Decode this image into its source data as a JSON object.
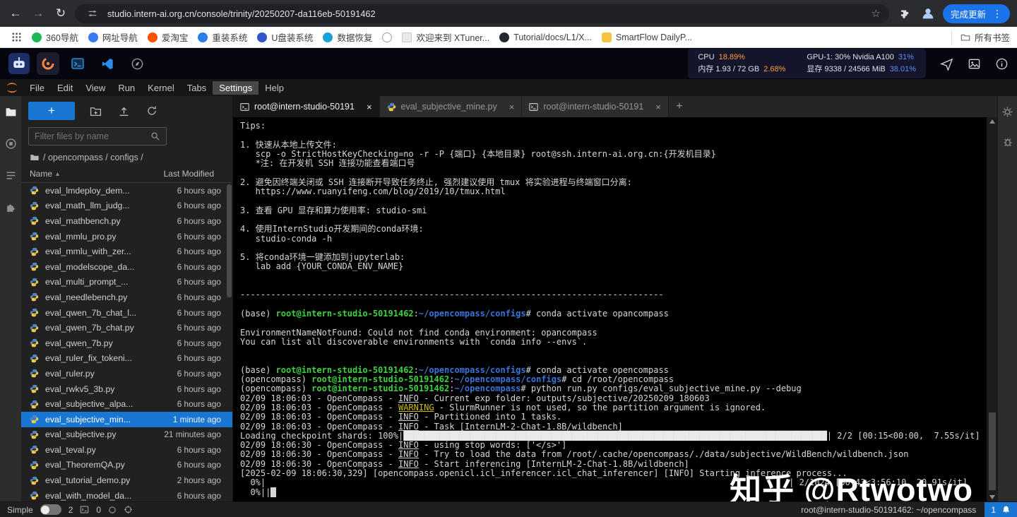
{
  "icons": {
    "back": "←",
    "forward": "→",
    "refresh": "↻",
    "star": "☆",
    "kebab": "⋮",
    "plus": "+",
    "caret": "▴",
    "close": "×"
  },
  "browser": {
    "url": "studio.intern-ai.org.cn/console/trinity/20250207-da116eb-50191462",
    "update_button": "完成更新",
    "all_bookmarks": "所有书签",
    "bookmarks": [
      {
        "label": "360导航",
        "color": "#1db954",
        "kind": "circle"
      },
      {
        "label": "网址导航",
        "color": "#3a7af0",
        "kind": "circle"
      },
      {
        "label": "爱淘宝",
        "color": "#ff5000",
        "kind": "circle"
      },
      {
        "label": "重装系统",
        "color": "#2b7de9",
        "kind": "circle"
      },
      {
        "label": "U盘装系统",
        "color": "#3355cc",
        "kind": "circle"
      },
      {
        "label": "数据恢复",
        "color": "#18a0d8",
        "kind": "circle"
      },
      {
        "label": "",
        "color": "#9aa0a6",
        "kind": "globe"
      },
      {
        "label": "欢迎来到 XTuner...",
        "color": "#e8eaed",
        "kind": "doc"
      },
      {
        "label": "Tutorial/docs/L1/X...",
        "color": "#24292f",
        "kind": "circle"
      },
      {
        "label": "SmartFlow DailyP...",
        "color": "#f6c443",
        "kind": "square"
      }
    ]
  },
  "studio": {
    "cpu_label": "CPU",
    "cpu_pct": "18.89%",
    "mem_label": "内存 1.93 / 72 GB",
    "mem_pct": "2.68%",
    "gpu_label": "GPU-1: 30% Nvidia A100",
    "gpu_pct": "31%",
    "vram_label": "显存 9338 / 24566 MiB",
    "vram_pct": "38.01%"
  },
  "menubar": {
    "items": [
      "File",
      "Edit",
      "View",
      "Run",
      "Kernel",
      "Tabs",
      "Settings",
      "Help"
    ],
    "active": "Settings"
  },
  "filebrowser": {
    "filter_placeholder": "Filter files by name",
    "breadcrumb": "/ opencompass / configs /",
    "col_name": "Name",
    "col_modified": "Last Modified"
  },
  "files": {
    "selected_index": 15,
    "items": [
      {
        "name": "eval_lmdeploy_dem...",
        "modified": "6 hours ago"
      },
      {
        "name": "eval_math_llm_judg...",
        "modified": "6 hours ago"
      },
      {
        "name": "eval_mathbench.py",
        "modified": "6 hours ago"
      },
      {
        "name": "eval_mmlu_pro.py",
        "modified": "6 hours ago"
      },
      {
        "name": "eval_mmlu_with_zer...",
        "modified": "6 hours ago"
      },
      {
        "name": "eval_modelscope_da...",
        "modified": "6 hours ago"
      },
      {
        "name": "eval_multi_prompt_...",
        "modified": "6 hours ago"
      },
      {
        "name": "eval_needlebench.py",
        "modified": "6 hours ago"
      },
      {
        "name": "eval_qwen_7b_chat_l...",
        "modified": "6 hours ago"
      },
      {
        "name": "eval_qwen_7b_chat.py",
        "modified": "6 hours ago"
      },
      {
        "name": "eval_qwen_7b.py",
        "modified": "6 hours ago"
      },
      {
        "name": "eval_ruler_fix_tokeni...",
        "modified": "6 hours ago"
      },
      {
        "name": "eval_ruler.py",
        "modified": "6 hours ago"
      },
      {
        "name": "eval_rwkv5_3b.py",
        "modified": "6 hours ago"
      },
      {
        "name": "eval_subjective_alpa...",
        "modified": "6 hours ago"
      },
      {
        "name": "eval_subjective_min...",
        "modified": "1 minute ago"
      },
      {
        "name": "eval_subjective.py",
        "modified": "21 minutes ago"
      },
      {
        "name": "eval_teval.py",
        "modified": "6 hours ago"
      },
      {
        "name": "eval_TheoremQA.py",
        "modified": "6 hours ago"
      },
      {
        "name": "eval_tutorial_demo.py",
        "modified": "2 hours ago"
      },
      {
        "name": "eval_with_model_da...",
        "modified": "6 hours ago"
      }
    ]
  },
  "tabs": [
    {
      "label": "root@intern-studio-50191",
      "icon": "terminal",
      "active": true
    },
    {
      "label": "eval_subjective_mine.py",
      "icon": "python",
      "active": false
    },
    {
      "label": "root@intern-studio-50191",
      "icon": "terminal",
      "active": false
    }
  ],
  "terminal": {
    "lines": [
      [
        "Tips:"
      ],
      [
        ""
      ],
      [
        "1. 快速从本地上传文件:"
      ],
      [
        "   scp -o StrictHostKeyChecking=no -r -P {端口} {本地目录} root@ssh.intern-ai.org.cn:{开发机目录}"
      ],
      [
        "   *注: 在开发机 SSH 连接功能查看端口号"
      ],
      [
        ""
      ],
      [
        "2. 避免因终端关闭或 SSH 连接断开导致任务终止, 强烈建议使用 tmux 将实验进程与终端窗口分离:"
      ],
      [
        "   https://www.ruanyifeng.com/blog/2019/10/tmux.html"
      ],
      [
        ""
      ],
      [
        "3. 查看 GPU 显存和算力使用率: studio-smi"
      ],
      [
        ""
      ],
      [
        "4. 使用InternStudio开发期间的conda环境:"
      ],
      [
        "   studio-conda -h"
      ],
      [
        ""
      ],
      [
        "5. 将conda环境一键添加到jupyterlab:"
      ],
      [
        "   lab add {YOUR_CONDA_ENV_NAME}"
      ],
      [
        ""
      ],
      [
        ""
      ],
      [
        "-----------------------------------------------------------------------------------"
      ],
      [
        ""
      ],
      [
        "(base) ",
        {
          "t": "root@intern-studio-50191462",
          "s": "g"
        },
        ":",
        {
          "t": "~/opencompass/configs",
          "s": "b"
        },
        "# conda activate opancompass"
      ],
      [
        ""
      ],
      [
        "EnvironmentNameNotFound: Could not find conda environment: opancompass"
      ],
      [
        "You can list all discoverable environments with `conda info --envs`."
      ],
      [
        ""
      ],
      [
        ""
      ],
      [
        "(base) ",
        {
          "t": "root@intern-studio-50191462",
          "s": "g"
        },
        ":",
        {
          "t": "~/opencompass/configs",
          "s": "b"
        },
        "# conda activate opencompass"
      ],
      [
        "(opencompass) ",
        {
          "t": "root@intern-studio-50191462",
          "s": "g"
        },
        ":",
        {
          "t": "~/opencompass/configs",
          "s": "b"
        },
        "# cd /root/opencompass"
      ],
      [
        "(opencompass) ",
        {
          "t": "root@intern-studio-50191462",
          "s": "g"
        },
        ":",
        {
          "t": "~/opencompass",
          "s": "b"
        },
        "# python run.py configs/eval_subjective_mine.py --debug"
      ],
      [
        "02/09 18:06:03 - OpenCompass - ",
        {
          "t": "INFO",
          "s": "u"
        },
        " - Current exp folder: outputs/subjective/20250209_180603"
      ],
      [
        "02/09 18:06:03 - OpenCompass - ",
        {
          "t": "WARNING",
          "s": "w"
        },
        " - SlurmRunner is not used, so the partition argument is ignored."
      ],
      [
        "02/09 18:06:03 - OpenCompass - ",
        {
          "t": "INFO",
          "s": "u"
        },
        " - Partitioned into 1 tasks."
      ],
      [
        "02/09 18:06:03 - OpenCompass - ",
        {
          "t": "INFO",
          "s": "u"
        },
        " - Task [InternLM-2-Chat-1.8B/wildbench]"
      ],
      [
        "Loading checkpoint shards: 100%|",
        {
          "t": "███████████████████████████████████████████████████████████████████████████████████",
          "s": "bar"
        },
        "| 2/2 [00:15<00:00,  7.55s/it]"
      ],
      [
        "02/09 18:06:30 - OpenCompass - ",
        {
          "t": "INFO",
          "s": "u"
        },
        " - using stop words: ['</s>']"
      ],
      [
        "02/09 18:06:30 - OpenCompass - ",
        {
          "t": "INFO",
          "s": "u"
        },
        " - Try to load the data from /root/.cache/opencompass/./data/subjective/WildBench/wildbench.json"
      ],
      [
        "02/09 18:06:30 - OpenCompass - ",
        {
          "t": "INFO",
          "s": "u"
        },
        " - Start inferencing [InternLM-2-Chat-1.8B/wildbench]"
      ],
      [
        "[2025-02-09 18:06:30,329] [opencompass.openicl.icl_inferencer.icl_chat_inferencer] [INFO] Starting inference process..."
      ],
      [
        "  0%|",
        {
          "t": "| 2/1024 [00:43<3:56:10, 20.91s/it]",
          "s": "right"
        }
      ],
      [
        "  0%||",
        {
          "t": " ",
          "s": "cur"
        }
      ]
    ]
  },
  "watermark": "知乎 @Rtwotwo",
  "statusbar": {
    "mode": "Simple",
    "terminals": "2",
    "kernels": "0",
    "session": "root@intern-studio-50191462: ~/opencompass",
    "notifications": "1"
  }
}
